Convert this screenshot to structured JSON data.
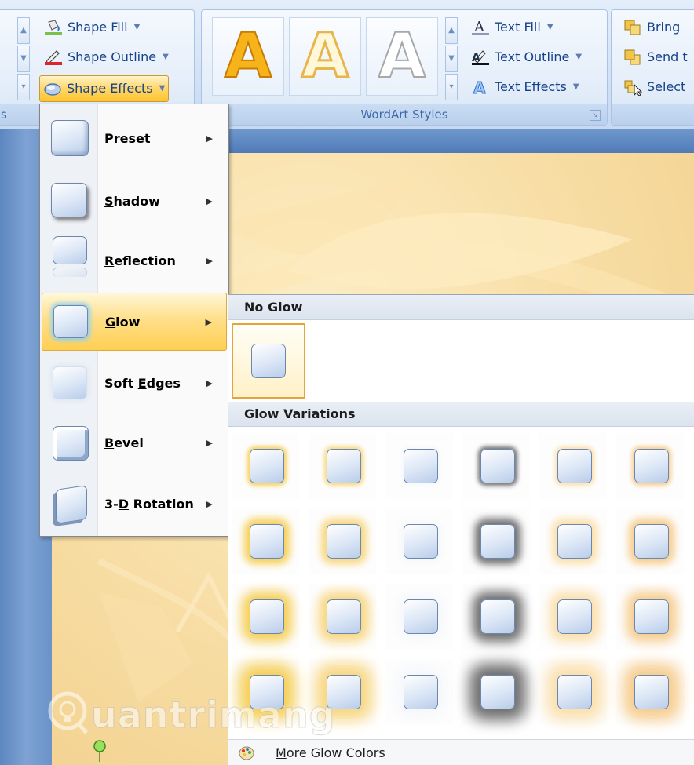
{
  "ribbon": {
    "drawing_group": {
      "shape_fill_label": "Shape Fill",
      "shape_outline_label": "Shape Outline",
      "shape_effects_label": "Shape Effects",
      "left_group_label_fragment": "s"
    },
    "wordart_group": {
      "label": "WordArt Styles",
      "gallery_tiles": [
        "A",
        "A",
        "A"
      ],
      "text_fill_label": "Text Fill",
      "text_outline_label": "Text Outline",
      "text_effects_label": "Text Effects"
    },
    "arrange_group": {
      "bring_label": "Bring",
      "send_label": "Send t",
      "select_label": "Select"
    }
  },
  "effects_menu": {
    "items": [
      {
        "pre": "",
        "u": "P",
        "post": "reset"
      },
      {
        "pre": "",
        "u": "S",
        "post": "hadow"
      },
      {
        "pre": "",
        "u": "R",
        "post": "eflection"
      },
      {
        "pre": "",
        "u": "G",
        "post": "low"
      },
      {
        "pre": "Soft ",
        "u": "E",
        "post": "dges"
      },
      {
        "pre": "",
        "u": "B",
        "post": "evel"
      },
      {
        "pre": "3-",
        "u": "D",
        "post": " Rotation"
      }
    ]
  },
  "glow_gallery": {
    "no_glow_heading": "No Glow",
    "variations_heading": "Glow Variations",
    "more_colors": {
      "pre": "",
      "u": "M",
      "post": "ore Glow Colors"
    },
    "column_colors": [
      "#f6cf58",
      "#f8d782",
      "#ffffff",
      "#6e6e6e",
      "#fbe0ad",
      "#f7cd8e"
    ]
  },
  "watermark": {
    "text": "uantrimang"
  },
  "colors": {
    "accent_orange": "#ffc42e",
    "ribbon_text": "#15428b"
  }
}
